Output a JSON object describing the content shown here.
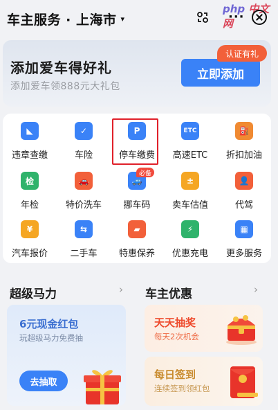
{
  "header": {
    "title": "车主服务 · 上海市",
    "caret": "▾",
    "more": "···",
    "watermark_a": "php",
    "watermark_b": "中文网"
  },
  "banner": {
    "title": "添加爱车得好礼",
    "subtitle": "添加爱车领888元大礼包",
    "button": "立即添加",
    "tag": "认证有礼"
  },
  "services": [
    {
      "label": "违章查缴",
      "icon": "camera-icon",
      "color": "#3a82f7",
      "glyph": "◣"
    },
    {
      "label": "车险",
      "icon": "shield-check-icon",
      "color": "#3a82f7",
      "glyph": "✓"
    },
    {
      "label": "停车缴费",
      "icon": "parking-icon",
      "color": "#3a82f7",
      "glyph": "P"
    },
    {
      "label": "高速ETC",
      "icon": "etc-icon",
      "color": "#3a82f7",
      "glyph": "ETC"
    },
    {
      "label": "折扣加油",
      "icon": "fuel-icon",
      "color": "#f08a32",
      "glyph": "⛽"
    },
    {
      "label": "年检",
      "icon": "inspection-icon",
      "color": "#2fb36b",
      "glyph": "检"
    },
    {
      "label": "特价洗车",
      "icon": "car-wash-icon",
      "color": "#f2603a",
      "glyph": "🚗"
    },
    {
      "label": "挪车码",
      "icon": "move-car-icon",
      "color": "#3a82f7",
      "glyph": "🚙"
    },
    {
      "label": "卖车估值",
      "icon": "valuation-icon",
      "color": "#f5a623",
      "glyph": "±"
    },
    {
      "label": "代驾",
      "icon": "driver-icon",
      "color": "#f2603a",
      "glyph": "👤"
    },
    {
      "label": "汽车报价",
      "icon": "yuan-icon",
      "color": "#f5a623",
      "glyph": "¥"
    },
    {
      "label": "二手车",
      "icon": "used-car-icon",
      "color": "#3a82f7",
      "glyph": "⇆"
    },
    {
      "label": "特惠保养",
      "icon": "oil-icon",
      "color": "#f2603a",
      "glyph": "▰"
    },
    {
      "label": "优惠充电",
      "icon": "charging-icon",
      "color": "#2fb36b",
      "glyph": "⚡"
    },
    {
      "label": "更多服务",
      "icon": "grid-more-icon",
      "color": "#3a82f7",
      "glyph": "▦"
    }
  ],
  "must_badge": "必备",
  "sections": {
    "left_title": "超级马力",
    "right_title": "车主优惠",
    "arrow": "›"
  },
  "promo_left": {
    "title": "6元现金红包",
    "subtitle": "玩超级马力免费抽",
    "button": "去抽取"
  },
  "promo_right_top": {
    "title": "天天抽奖",
    "subtitle": "每天2次机会",
    "title_color": "#ee4a2c",
    "sub_color": "#ee6a44"
  },
  "promo_right_bottom": {
    "title": "每日签到",
    "subtitle": "连续签到领红包",
    "title_color": "#c88a2c",
    "sub_color": "#c89a55"
  }
}
